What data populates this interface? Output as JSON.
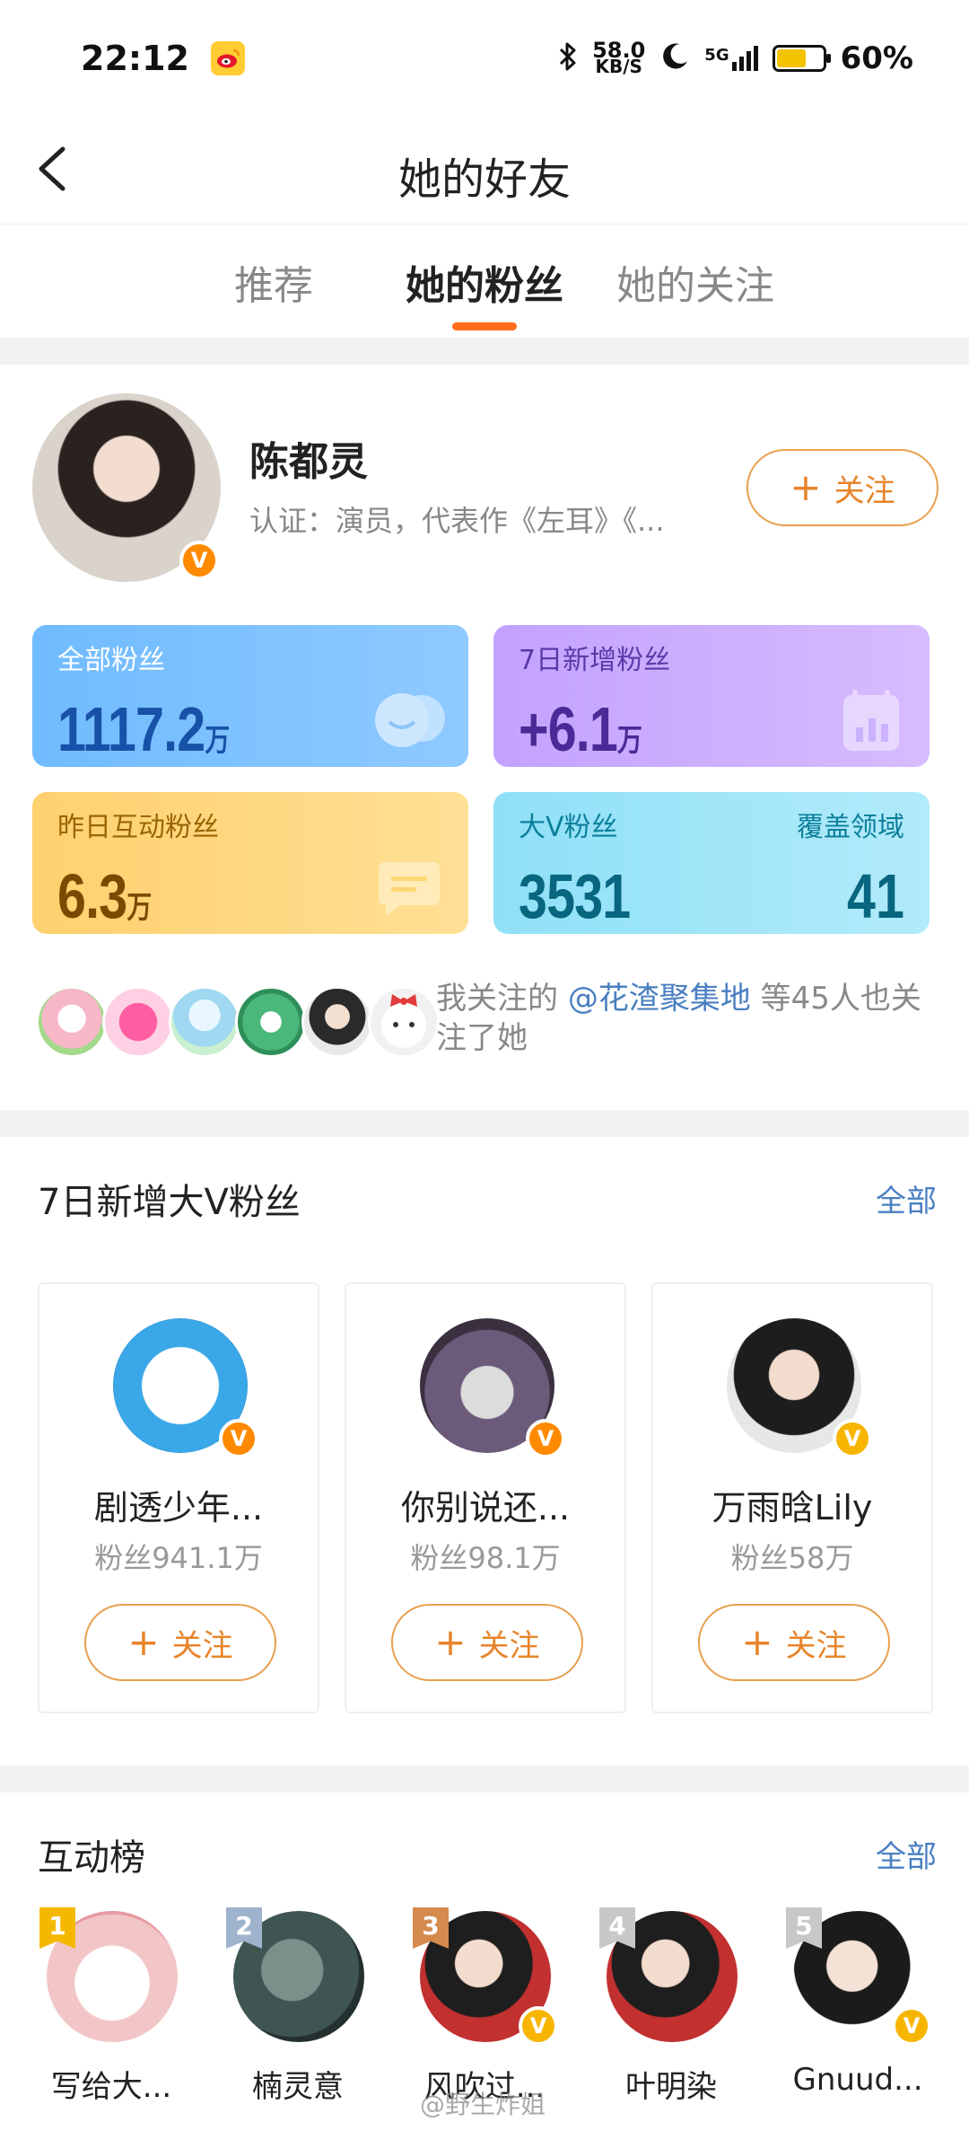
{
  "status": {
    "time": "22:12",
    "net_speed_value": "58.0",
    "net_speed_unit": "KB/S",
    "network": "5G",
    "battery": "60%"
  },
  "nav": {
    "title": "她的好友"
  },
  "tabs": [
    {
      "label": "推荐"
    },
    {
      "label": "她的粉丝",
      "active": true
    },
    {
      "label": "她的关注"
    }
  ],
  "profile": {
    "name": "陈都灵",
    "certification": "认证：演员，代表作《左耳》《...",
    "follow_label": "关注",
    "verified": "V"
  },
  "stats": {
    "total_fans": {
      "label": "全部粉丝",
      "value": "1117.2",
      "unit": "万"
    },
    "new_fans_7d": {
      "label": "7日新增粉丝",
      "value": "+6.1",
      "unit": "万"
    },
    "interactive_fans_yesterday": {
      "label": "昨日互动粉丝",
      "value": "6.3",
      "unit": "万"
    },
    "big_v_fans": {
      "label": "大V粉丝",
      "value": "3531",
      "coverage_label": "覆盖领域",
      "coverage_value": "41"
    }
  },
  "mutual": {
    "prefix": "我关注的 ",
    "highlight": "@花渣聚集地",
    "suffix": " 等45人也关注了她"
  },
  "big_v_section": {
    "title": "7日新增大V粉丝",
    "all_label": "全部",
    "cards": [
      {
        "name": "剧透少年...",
        "fans": "粉丝941.1万",
        "follow_label": "关注",
        "badge": "V",
        "accent": "#ff8a00"
      },
      {
        "name": "你别说还...",
        "fans": "粉丝98.1万",
        "follow_label": "关注",
        "badge": "V",
        "accent": "#ff8a00"
      },
      {
        "name": "万雨晗Lily",
        "fans": "粉丝58万",
        "follow_label": "关注",
        "badge": "V",
        "accent": "#f7b500"
      }
    ]
  },
  "ranking_section": {
    "title": "互动榜",
    "all_label": "全部",
    "items": [
      {
        "rank": "1",
        "name": "写给大...",
        "badge_color": "#f5b800"
      },
      {
        "rank": "2",
        "name": "楠灵意",
        "badge_color": "#9fb3cc"
      },
      {
        "rank": "3",
        "name": "风吹过...",
        "badge_color": "#d58a4e",
        "verified": "V"
      },
      {
        "rank": "4",
        "name": "叶明染",
        "badge_color": "#c8c8c8"
      },
      {
        "rank": "5",
        "name": "Gnuud...",
        "badge_color": "#c8c8c8",
        "verified": "V"
      }
    ]
  },
  "watermark": "@野生炸姐",
  "colors": {
    "accent_orange": "#ff6d1b",
    "link_blue": "#4a7fc1",
    "follow_border": "#e8a050"
  }
}
